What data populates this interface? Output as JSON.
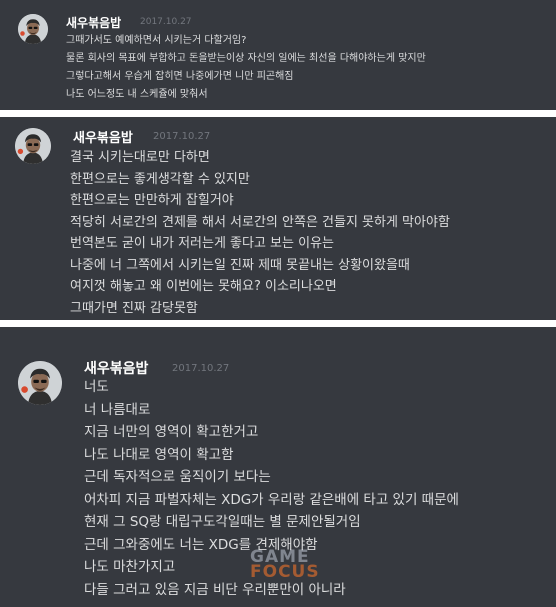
{
  "messages": [
    {
      "author": "새우볶음밥",
      "timestamp": "2017.10.27",
      "avatar_icon": "user-avatar-icon",
      "lines": [
        "그때가서도 예예하면서 시키는거 다할거임?",
        "물론 회사의 목표에 부합하고 돈을받는이상 자신의 일에는 최선을 다해야하는게 맞지만",
        "그렇다고해서 우습게 잡히면 나중에가면 니만 피곤해짐",
        "나도 어느정도 내 스케쥴에 맞춰서"
      ]
    },
    {
      "author": "새우볶음밥",
      "timestamp": "2017.10.27",
      "avatar_icon": "user-avatar-icon",
      "lines": [
        "결국 시키는대로만 다하면",
        "한편으로는 좋게생각할 수 있지만",
        "한편으로는 만만하게 잡힐거야",
        "적당히 서로간의 견제를 해서 서로간의 안쪽은 건들지 못하게 막아야함",
        "번역본도 굳이 내가 저러는게 좋다고 보는 이유는",
        "나중에 너 그쪽에서 시키는일 진짜 제때 못끝내는 상황이왔을때",
        "여지껏 해놓고 왜 이번에는 못해요? 이소리나오면",
        "그때가면 진짜 감당못함"
      ]
    },
    {
      "author": "새우볶음밥",
      "timestamp": "2017.10.27",
      "avatar_icon": "user-avatar-icon",
      "lines": [
        "너도",
        "너 나름대로",
        "지금 너만의 영역이 확고한거고",
        "나도 나대로 영역이 확고함",
        "근데 독자적으로 움직이기 보다는",
        "어차피 지금 파벌자체는 XDG가 우리랑 같은배에 타고 있기 때문에",
        "현재 그 SQ랑 대립구도각일때는 별 문제안될거임",
        "근데 그와중에도 너는 XDG를 견제해야함",
        "나도 마찬가지고",
        "다들 그러고 있음 지금 비단 우리뿐만이 아니라"
      ]
    }
  ],
  "watermark": {
    "line1": "GAME",
    "line2": "FOCUS"
  },
  "colors": {
    "panel_bg": "#36393f",
    "separator": "#ffffff",
    "author": "#ffffff",
    "timestamp": "#72767d",
    "message_text": "#dcddde"
  }
}
